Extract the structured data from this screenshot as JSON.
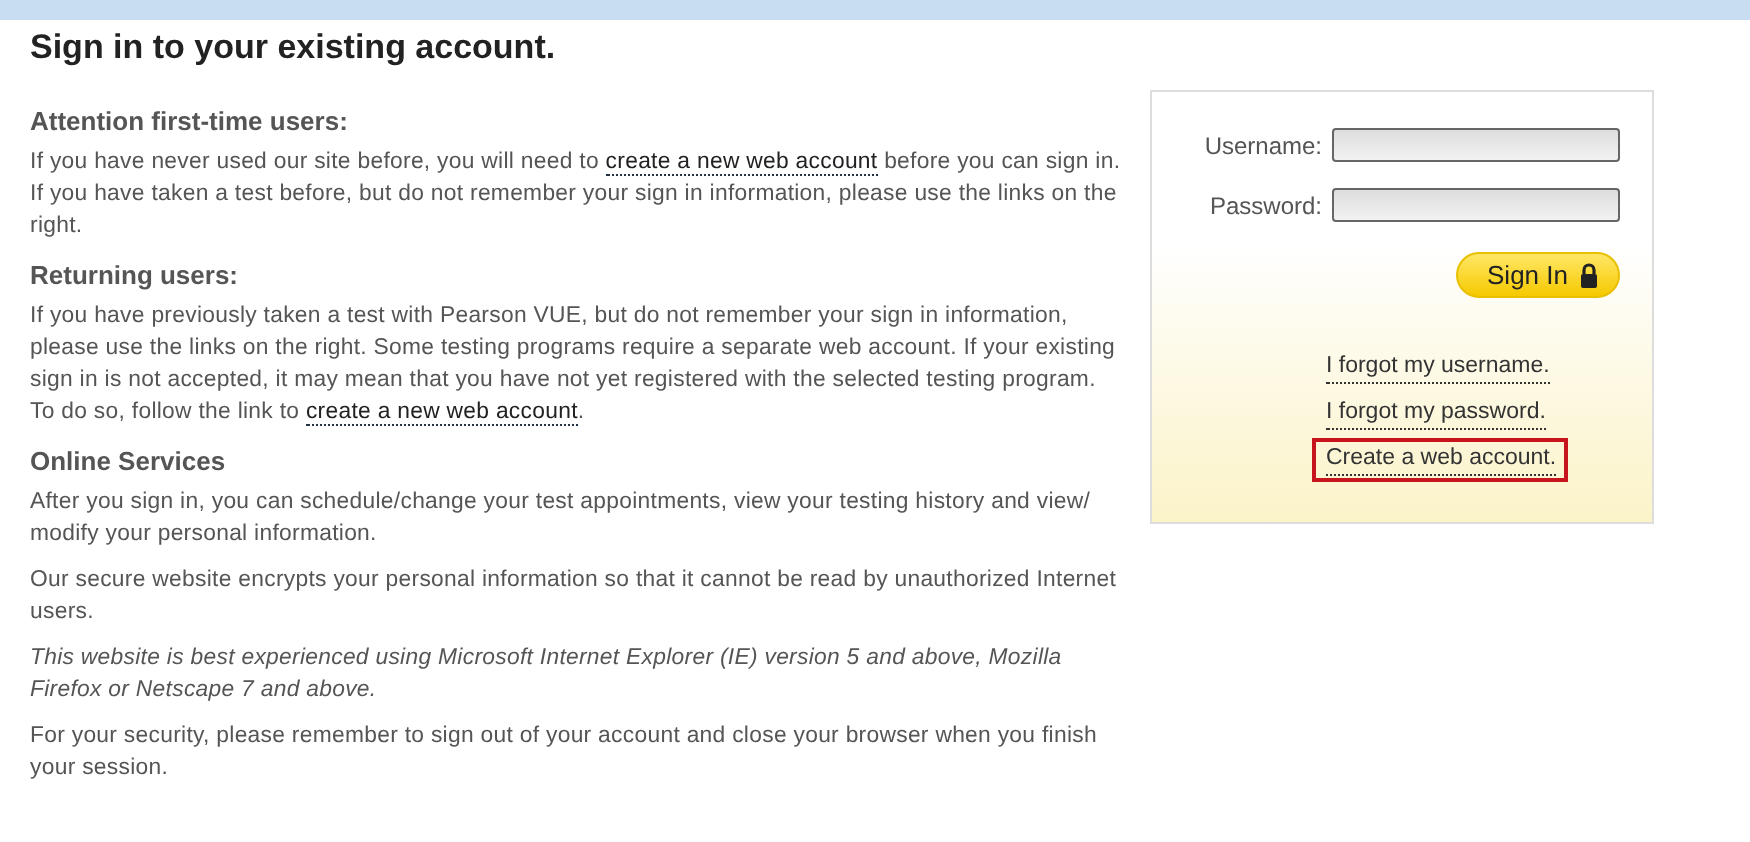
{
  "title": "Sign in to your existing account.",
  "sections": [
    {
      "heading": "Attention first-time users:",
      "paragraphs": [
        {
          "kind": "plain",
          "before": "If you have never used our site before, you will need to ",
          "link": "create a new web account",
          "after": " before you can sign in. If you have taken a test before, but do not remember your sign in information, please use the links on the right."
        }
      ]
    },
    {
      "heading": "Returning users:",
      "paragraphs": [
        {
          "kind": "plain",
          "before": "If you have previously taken a test with Pearson VUE, but do not remember your sign in information, please use the links on the right. Some testing programs require a separate web account. If your existing sign in is not accepted, it may mean that you have not yet registered with the selected testing program. To do so, follow the link to ",
          "link": "create a new web account",
          "after": "."
        }
      ]
    },
    {
      "heading": "Online Services",
      "paragraphs": [
        {
          "kind": "plain",
          "before": "After you sign in, you can schedule/change your test appointments, view your testing history and view/ modify your personal information."
        },
        {
          "kind": "plain",
          "before": "Our secure website encrypts your personal information so that it cannot be read by unauthorized Internet users."
        },
        {
          "kind": "note",
          "before": "This website is best experienced using Microsoft Internet Explorer (IE) version 5 and above, Mozilla Firefox or Netscape 7 and above."
        },
        {
          "kind": "plain",
          "before": "For your security, please remember to sign out of your account and close your browser when you finish your session."
        }
      ]
    }
  ],
  "signin": {
    "fields": [
      {
        "label": "Username:"
      },
      {
        "label": "Password:"
      }
    ],
    "button": "Sign In",
    "links": [
      {
        "text": "I forgot my username.",
        "highlighted": false
      },
      {
        "text": "I forgot my password.",
        "highlighted": false
      },
      {
        "text": "Create a web account.",
        "highlighted": true
      }
    ]
  }
}
